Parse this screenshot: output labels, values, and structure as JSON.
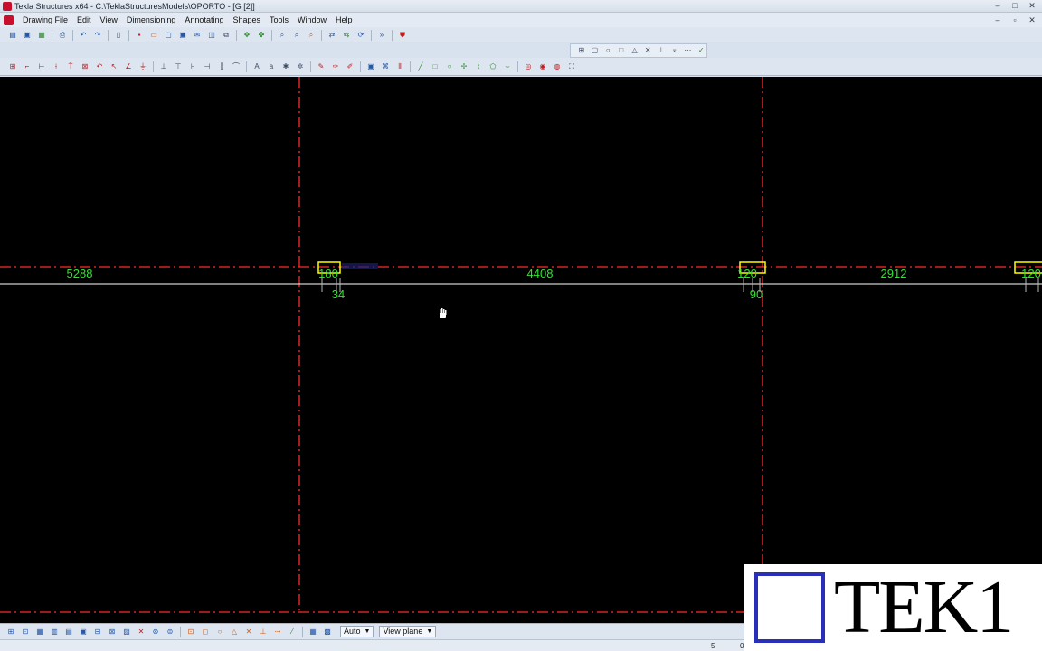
{
  "window": {
    "title": "Tekla Structures x64 - C:\\TeklaStructuresModels\\OPORTO - [G  [2]]",
    "controls": [
      "–",
      "□",
      "✕"
    ]
  },
  "menu": {
    "items": [
      "Drawing File",
      "Edit",
      "View",
      "Dimensioning",
      "Annotating",
      "Shapes",
      "Tools",
      "Window",
      "Help"
    ],
    "doc_controls": [
      "–",
      "▫",
      "✕"
    ]
  },
  "bottom_toolbar": {
    "auto_label": "Auto",
    "plane_label": "View plane"
  },
  "status": {
    "value_1": "5",
    "value_2": "0"
  },
  "drawing": {
    "background": "#000000",
    "gridline_color": "#ff2a2a",
    "dimension_color": "#35e135",
    "highlight_color": "#ffff00",
    "labels": {
      "dim_5288": "5288",
      "dim_4408": "4408",
      "dim_2912": "2912",
      "dim_180": "180",
      "dim_34": "34",
      "dim_120a": "120",
      "dim_90": "90",
      "dim_120b": "120"
    }
  },
  "logo": {
    "text": "TEK1"
  }
}
